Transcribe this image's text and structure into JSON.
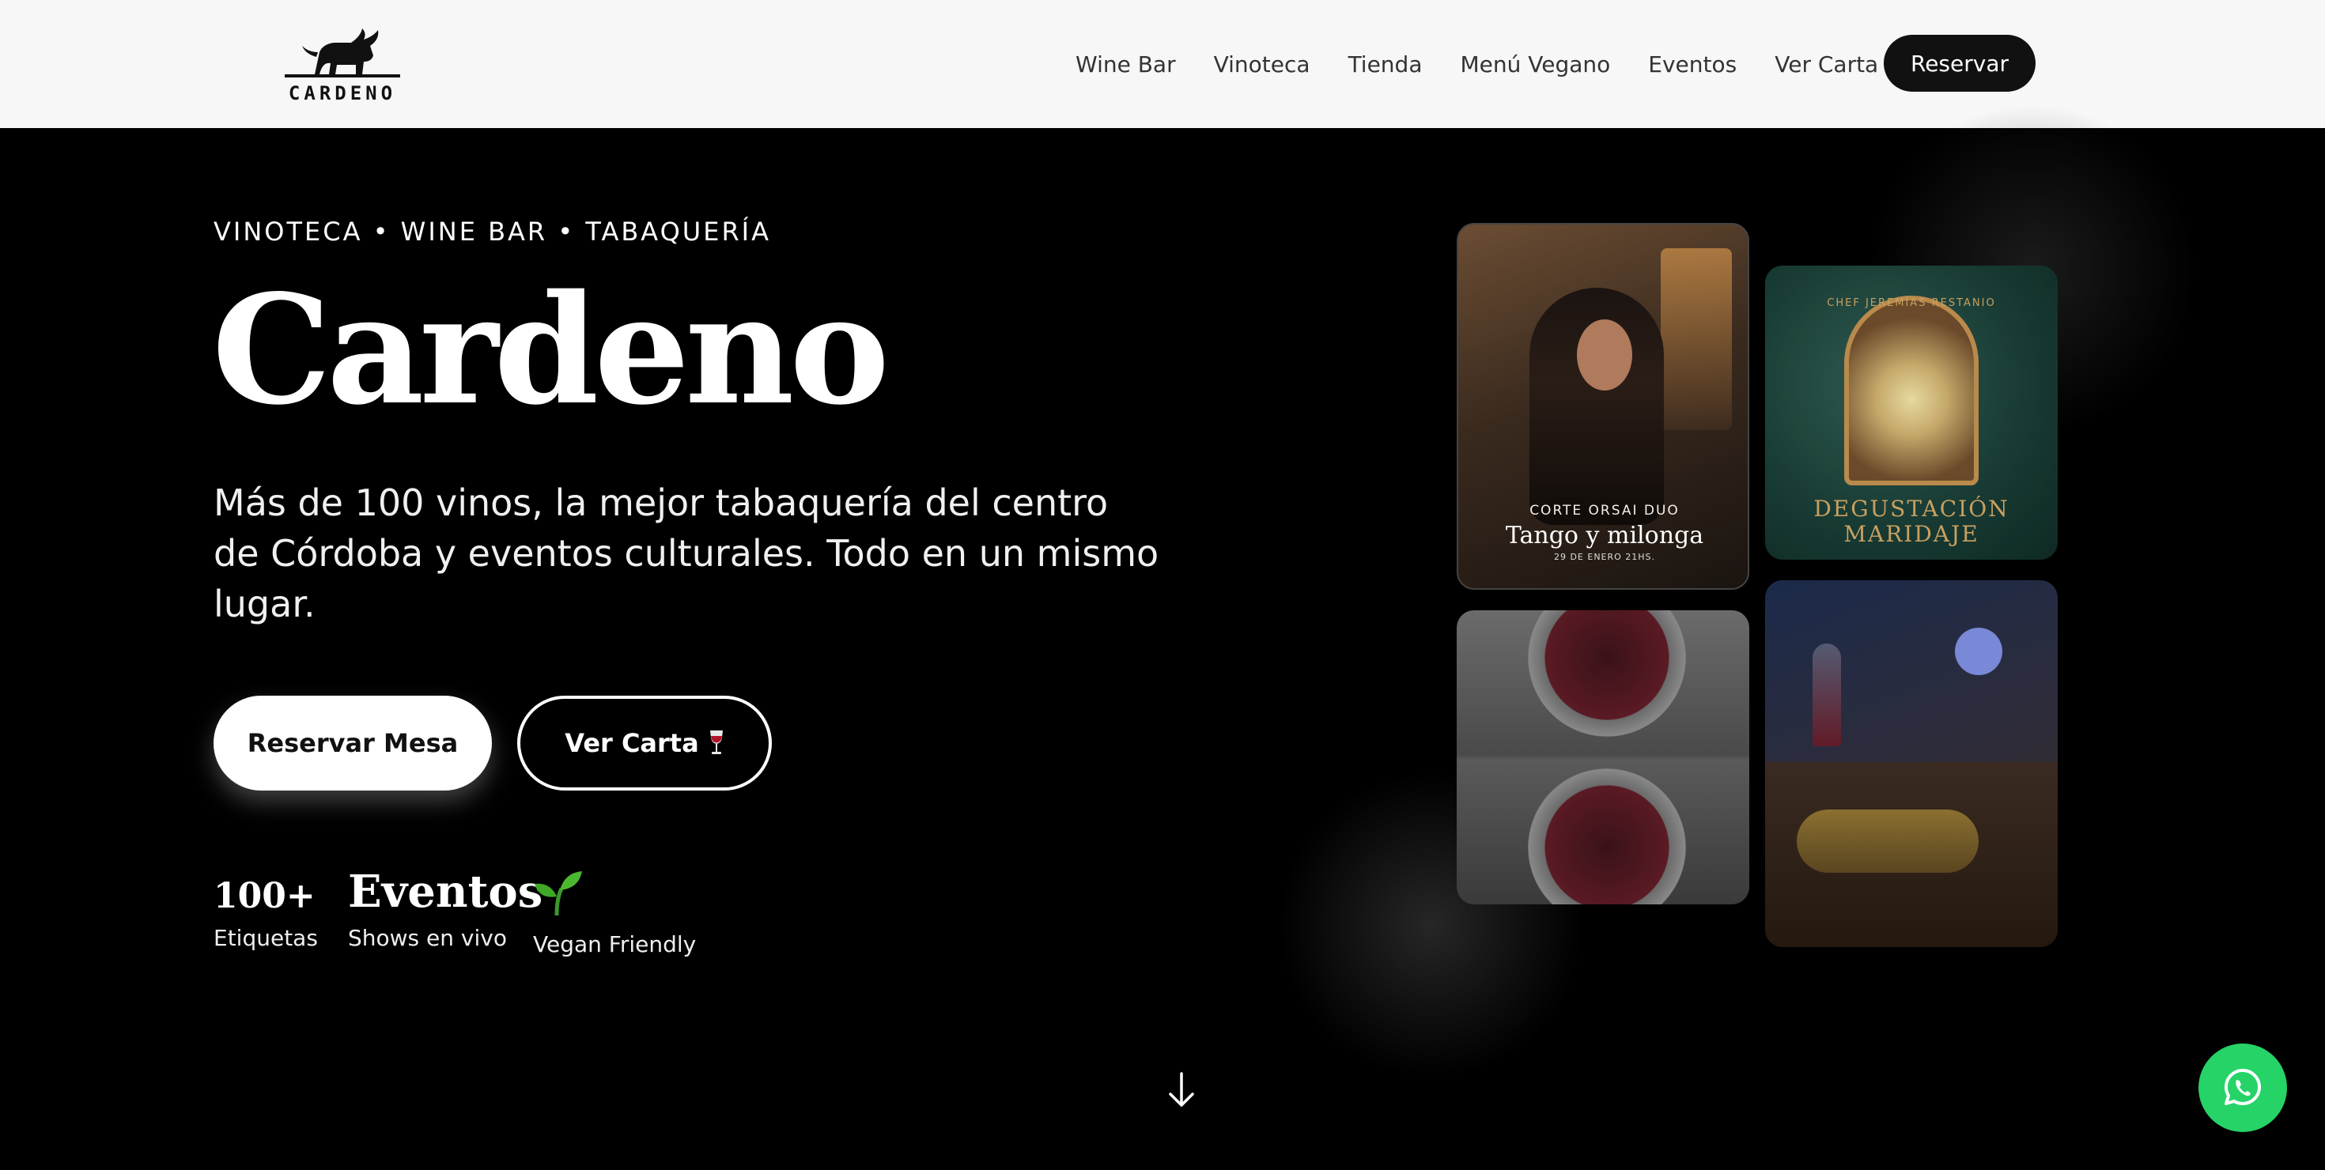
{
  "brand": {
    "name": "CARDENO"
  },
  "nav": {
    "items": [
      "Wine Bar",
      "Vinoteca",
      "Tienda",
      "Menú Vegano",
      "Eventos",
      "Ver Carta"
    ],
    "cta": "Reservar"
  },
  "hero": {
    "kicker": "VINOTECA • WINE BAR • TABAQUERÍA",
    "title": "Cardeno",
    "subtitle": "Más de 100 vinos, la mejor tabaquería del centro de Córdoba y eventos culturales. Todo en un mismo lugar.",
    "primary_button": "Reservar Mesa",
    "secondary_button": "Ver Carta",
    "secondary_icon": "wine-glass-icon"
  },
  "stats": [
    {
      "value": "100+",
      "label": "Etiquetas"
    },
    {
      "value": "Eventos",
      "label": "Shows en vivo"
    },
    {
      "icon": "seedling-icon",
      "label": "Vegan Friendly"
    }
  ],
  "gallery": {
    "card1": {
      "small": "CORTE ORSAI DUO",
      "title": "Tango y milonga",
      "date": "29 DE ENERO 21HS."
    },
    "card2": {
      "chef": "CHEF JEREMÍAS RESTANIO",
      "title_line1": "DEGUSTACIÓN",
      "title_line2": "MARIDAJE"
    }
  },
  "icons": {
    "scroll": "arrow-down-icon",
    "whatsapp": "whatsapp-icon"
  },
  "colors": {
    "whatsapp": "#25d366",
    "header_bg": "#f7f7f7",
    "accent_dark": "#111111"
  }
}
